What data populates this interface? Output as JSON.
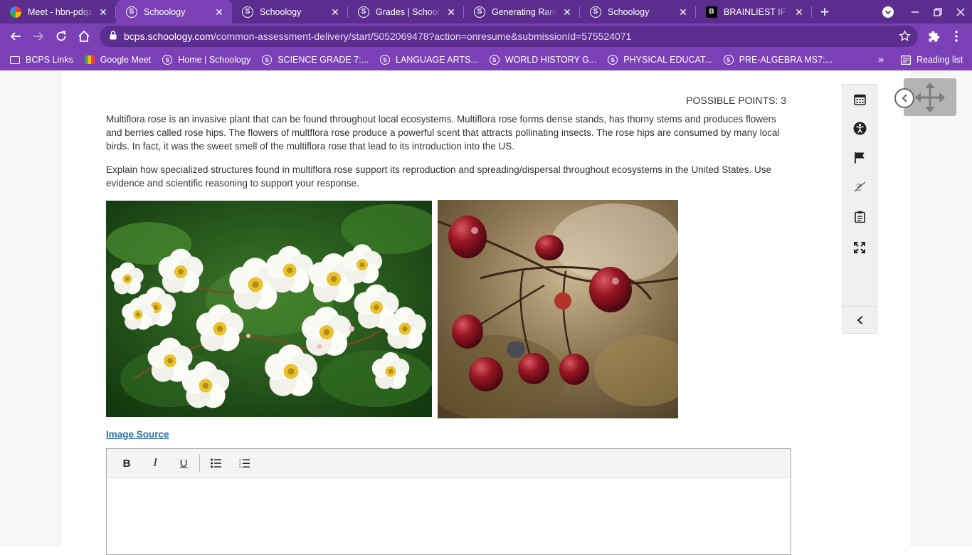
{
  "browser": {
    "tabs": [
      {
        "title": "Meet - hbn-pdqz-tib",
        "favicon": "google-meet-icon",
        "active": false
      },
      {
        "title": "Schoology",
        "favicon": "schoology-icon",
        "active": true
      },
      {
        "title": "Schoology",
        "favicon": "schoology-icon",
        "active": false
      },
      {
        "title": "Grades | Schoology",
        "favicon": "schoology-icon",
        "active": false
      },
      {
        "title": "Generating Random",
        "favicon": "schoology-icon",
        "active": false
      },
      {
        "title": "Schoology",
        "favicon": "schoology-icon",
        "active": false
      },
      {
        "title": "BRAINLIEST IF CORR",
        "favicon": "brainly-icon",
        "active": false
      }
    ],
    "url_host": "bcps.schoology.com",
    "url_path": "/common-assessment-delivery/start/5052069478?action=onresume&submissionId=575524071",
    "bookmarks": [
      {
        "label": "BCPS Links",
        "icon": "folder-icon"
      },
      {
        "label": "Google Meet",
        "icon": "google-meet-icon"
      },
      {
        "label": "Home | Schoology",
        "icon": "schoology-icon"
      },
      {
        "label": "SCIENCE GRADE 7:...",
        "icon": "schoology-icon"
      },
      {
        "label": "LANGUAGE ARTS...",
        "icon": "schoology-icon"
      },
      {
        "label": "WORLD HISTORY G...",
        "icon": "schoology-icon"
      },
      {
        "label": "PHYSICAL EDUCAT...",
        "icon": "schoology-icon"
      },
      {
        "label": "PRE-ALGEBRA MS7:...",
        "icon": "schoology-icon"
      }
    ],
    "overflow": "»",
    "reading_list": "Reading list",
    "colors": {
      "tabstrip": "#5b2d8e",
      "toolbar": "#7b40b6"
    }
  },
  "question": {
    "possible_points": "POSSIBLE POINTS: 3",
    "paragraph1": "Multiflora rose is an invasive plant that can be found throughout local ecosystems.  Multiflora rose forms dense stands, has thorny stems and produces flowers and berries called rose hips.  The flowers of multflora rose produce a powerful scent that attracts pollinating insects.  The rose hips are consumed by many local birds.  In fact, it was the sweet smell of the multiflora rose that lead to its introduction into the US.",
    "paragraph2": "Explain how specialized structures found in multiflora rose support its reproduction and spreading/dispersal throughout ecosystems in the United States. Use evidence and scientific reasoning to support your response.",
    "image_source_link": "Image Source"
  },
  "editor": {
    "bold": "B",
    "italic": "I",
    "underline": "U",
    "value": ""
  },
  "colors": {
    "link": "#2a73a8",
    "text": "#333333"
  }
}
